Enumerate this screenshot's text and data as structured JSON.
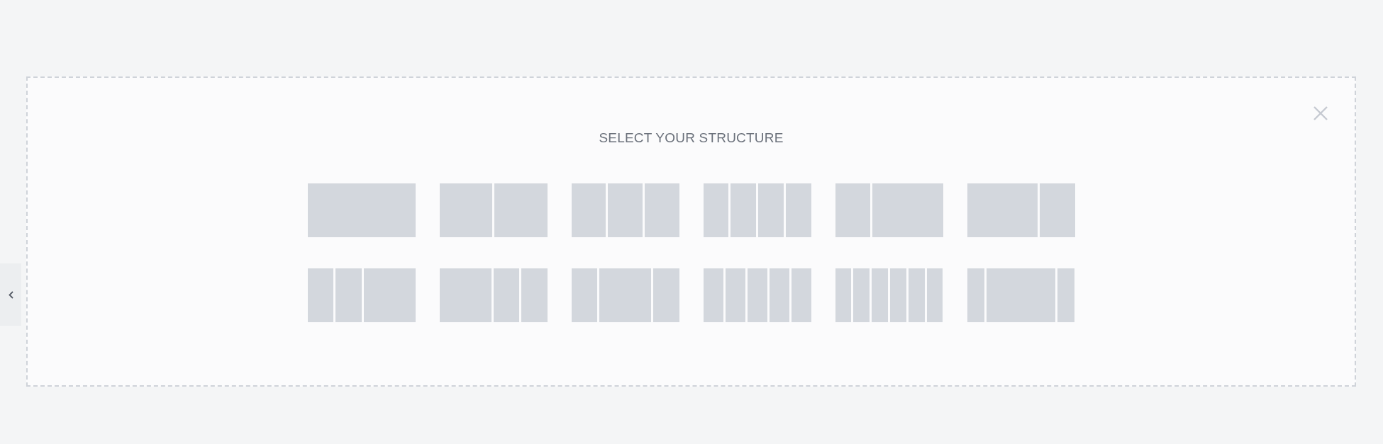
{
  "title": "SELECT YOUR STRUCTURE",
  "rows": [
    {
      "structures": [
        {
          "kind": "single"
        },
        {
          "kind": "halves"
        },
        {
          "kind": "thirds"
        },
        {
          "kind": "quarters"
        },
        {
          "kind": "narrow-wide"
        },
        {
          "kind": "wide-narrow"
        }
      ]
    },
    {
      "structures": [
        {
          "kind": "narrow-narrow-wide"
        },
        {
          "kind": "wide-narrow-narrow"
        },
        {
          "kind": "narrow-wide-narrow"
        },
        {
          "kind": "fifths"
        },
        {
          "kind": "sixths"
        },
        {
          "kind": "slim-wide-slim"
        }
      ]
    }
  ]
}
